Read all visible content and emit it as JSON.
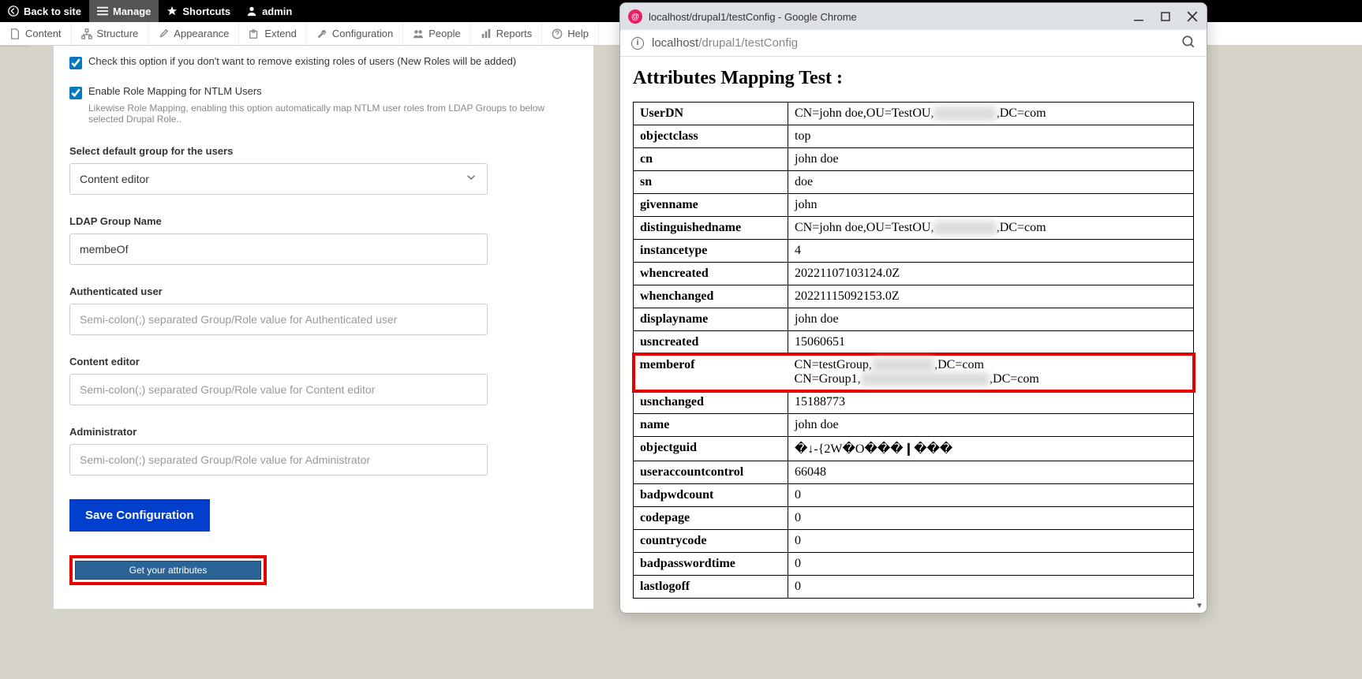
{
  "topbar": {
    "back": "Back to site",
    "manage": "Manage",
    "shortcuts": "Shortcuts",
    "admin": "admin"
  },
  "admintoolbar": {
    "content": "Content",
    "structure": "Structure",
    "appearance": "Appearance",
    "extend": "Extend",
    "configuration": "Configuration",
    "people": "People",
    "reports": "Reports",
    "help": "Help"
  },
  "form": {
    "check1_label": "Check this option if you don't want to remove existing roles of users (New Roles will be added)",
    "check2_label": "Enable Role Mapping for NTLM Users",
    "check2_desc": "Likewise Role Mapping, enabling this option automatically map NTLM user roles from LDAP Groups to below selected Drupal Role..",
    "default_group_label": "Select default group for the users",
    "default_group_value": "Content editor",
    "ldap_group_label": "LDAP Group Name",
    "ldap_group_value": "membeOf",
    "auth_user_label": "Authenticated user",
    "auth_user_placeholder": "Semi-colon(;) separated Group/Role value for Authenticated user",
    "content_editor_label": "Content editor",
    "content_editor_placeholder": "Semi-colon(;) separated Group/Role value for Content editor",
    "admin_label": "Administrator",
    "admin_placeholder": "Semi-colon(;) separated Group/Role value for Administrator",
    "save_btn": "Save Configuration",
    "get_attr_btn": "Get your attributes"
  },
  "chrome": {
    "title": "localhost/drupal1/testConfig - Google Chrome",
    "url_host": "localhost",
    "url_path": "/drupal1/testConfig",
    "heading": "Attributes Mapping Test :",
    "rows": [
      {
        "k": "UserDN",
        "v": "CN=john doe,OU=TestOU,",
        "blur": "DC=xxxxxx",
        "v2": ",DC=com"
      },
      {
        "k": "objectclass",
        "v": "top"
      },
      {
        "k": "cn",
        "v": "john doe"
      },
      {
        "k": "sn",
        "v": "doe"
      },
      {
        "k": "givenname",
        "v": "john"
      },
      {
        "k": "distinguishedname",
        "v": "CN=john doe,OU=TestOU,",
        "blur": "DC=xxxxxx",
        "v2": ",DC=com"
      },
      {
        "k": "instancetype",
        "v": "4"
      },
      {
        "k": "whencreated",
        "v": "20221107103124.0Z"
      },
      {
        "k": "whenchanged",
        "v": "20221115092153.0Z"
      },
      {
        "k": "displayname",
        "v": "john doe"
      },
      {
        "k": "usncreated",
        "v": "15060651"
      },
      {
        "k": "memberof",
        "line1a": "CN=testGroup,",
        "line1b": "DC=xxxxxx",
        "line1c": ",DC=com",
        "line2a": "CN=Group1,",
        "line2b": "OU=xxxxxx,DC=xxxxxx",
        "line2c": ",DC=com",
        "highlight": true
      },
      {
        "k": "usnchanged",
        "v": "15188773"
      },
      {
        "k": "name",
        "v": "john doe"
      },
      {
        "k": "objectguid",
        "v": "�↓-{2W�O���❙���"
      },
      {
        "k": "useraccountcontrol",
        "v": "66048"
      },
      {
        "k": "badpwdcount",
        "v": "0"
      },
      {
        "k": "codepage",
        "v": "0"
      },
      {
        "k": "countrycode",
        "v": "0"
      },
      {
        "k": "badpasswordtime",
        "v": "0"
      },
      {
        "k": "lastlogoff",
        "v": "0"
      }
    ]
  }
}
